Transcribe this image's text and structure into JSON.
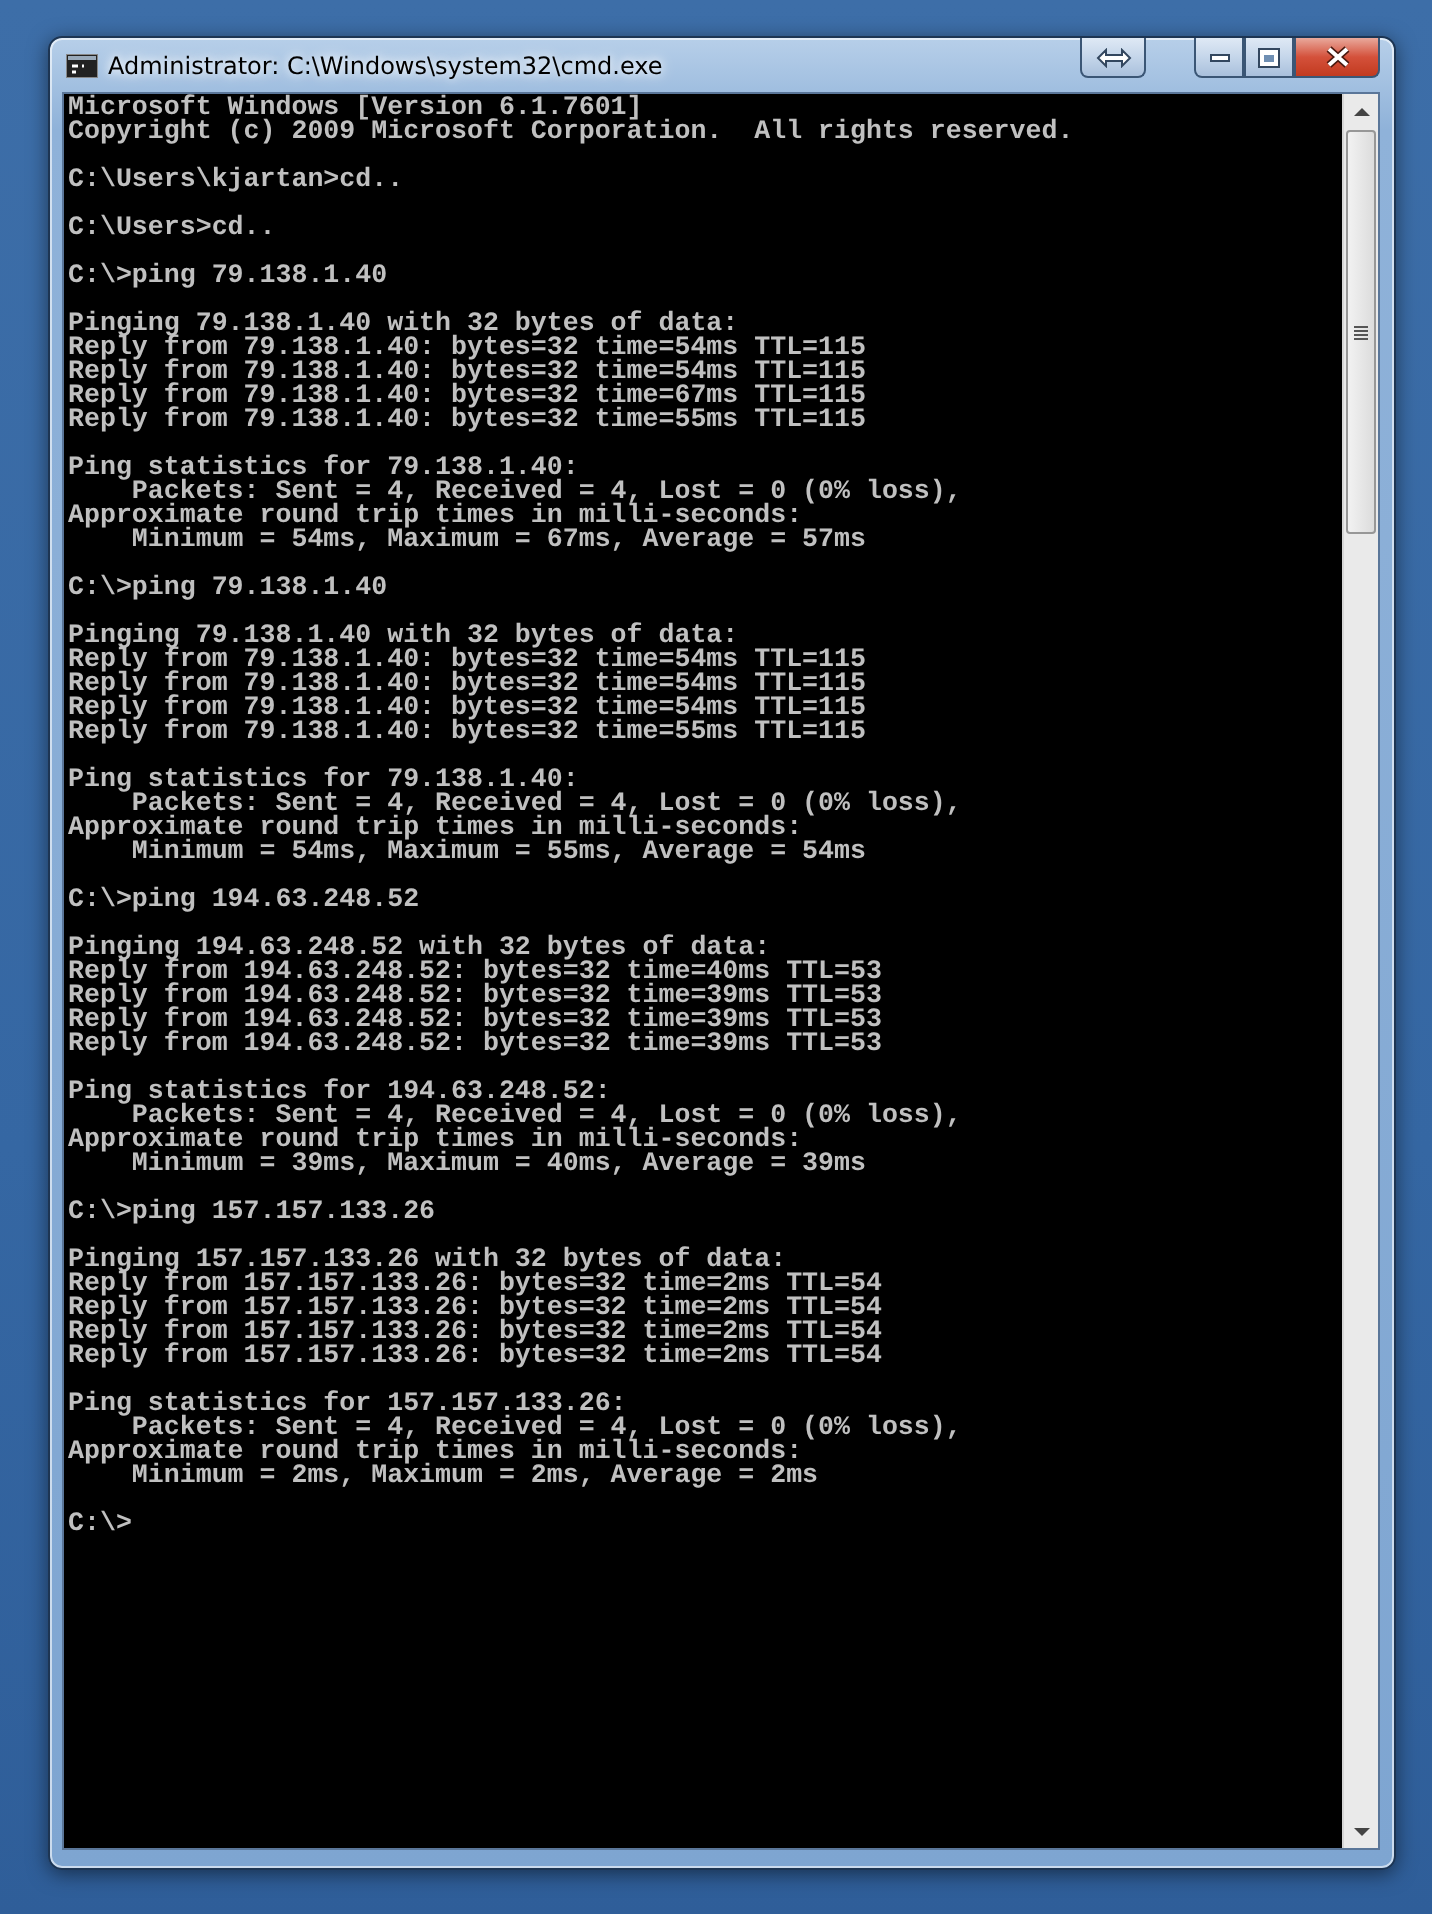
{
  "window": {
    "title": "Administrator: C:\\Windows\\system32\\cmd.exe"
  },
  "console": {
    "blocks": [
      [
        "Microsoft Windows [Version 6.1.7601]",
        "Copyright (c) 2009 Microsoft Corporation.  All rights reserved."
      ],
      [
        "C:\\Users\\kjartan>cd.."
      ],
      [
        "C:\\Users>cd.."
      ],
      [
        "C:\\>ping 79.138.1.40"
      ],
      [
        "Pinging 79.138.1.40 with 32 bytes of data:",
        "Reply from 79.138.1.40: bytes=32 time=54ms TTL=115",
        "Reply from 79.138.1.40: bytes=32 time=54ms TTL=115",
        "Reply from 79.138.1.40: bytes=32 time=67ms TTL=115",
        "Reply from 79.138.1.40: bytes=32 time=55ms TTL=115"
      ],
      [
        "Ping statistics for 79.138.1.40:",
        "    Packets: Sent = 4, Received = 4, Lost = 0 (0% loss),",
        "Approximate round trip times in milli-seconds:",
        "    Minimum = 54ms, Maximum = 67ms, Average = 57ms"
      ],
      [
        "C:\\>ping 79.138.1.40"
      ],
      [
        "Pinging 79.138.1.40 with 32 bytes of data:",
        "Reply from 79.138.1.40: bytes=32 time=54ms TTL=115",
        "Reply from 79.138.1.40: bytes=32 time=54ms TTL=115",
        "Reply from 79.138.1.40: bytes=32 time=54ms TTL=115",
        "Reply from 79.138.1.40: bytes=32 time=55ms TTL=115"
      ],
      [
        "Ping statistics for 79.138.1.40:",
        "    Packets: Sent = 4, Received = 4, Lost = 0 (0% loss),",
        "Approximate round trip times in milli-seconds:",
        "    Minimum = 54ms, Maximum = 55ms, Average = 54ms"
      ],
      [
        "C:\\>ping 194.63.248.52"
      ],
      [
        "Pinging 194.63.248.52 with 32 bytes of data:",
        "Reply from 194.63.248.52: bytes=32 time=40ms TTL=53",
        "Reply from 194.63.248.52: bytes=32 time=39ms TTL=53",
        "Reply from 194.63.248.52: bytes=32 time=39ms TTL=53",
        "Reply from 194.63.248.52: bytes=32 time=39ms TTL=53"
      ],
      [
        "Ping statistics for 194.63.248.52:",
        "    Packets: Sent = 4, Received = 4, Lost = 0 (0% loss),",
        "Approximate round trip times in milli-seconds:",
        "    Minimum = 39ms, Maximum = 40ms, Average = 39ms"
      ],
      [
        "C:\\>ping 157.157.133.26"
      ],
      [
        "Pinging 157.157.133.26 with 32 bytes of data:",
        "Reply from 157.157.133.26: bytes=32 time=2ms TTL=54",
        "Reply from 157.157.133.26: bytes=32 time=2ms TTL=54",
        "Reply from 157.157.133.26: bytes=32 time=2ms TTL=54",
        "Reply from 157.157.133.26: bytes=32 time=2ms TTL=54"
      ],
      [
        "Ping statistics for 157.157.133.26:",
        "    Packets: Sent = 4, Received = 4, Lost = 0 (0% loss),",
        "Approximate round trip times in milli-seconds:",
        "    Minimum = 2ms, Maximum = 2ms, Average = 2ms"
      ],
      [
        "C:\\>"
      ]
    ]
  }
}
